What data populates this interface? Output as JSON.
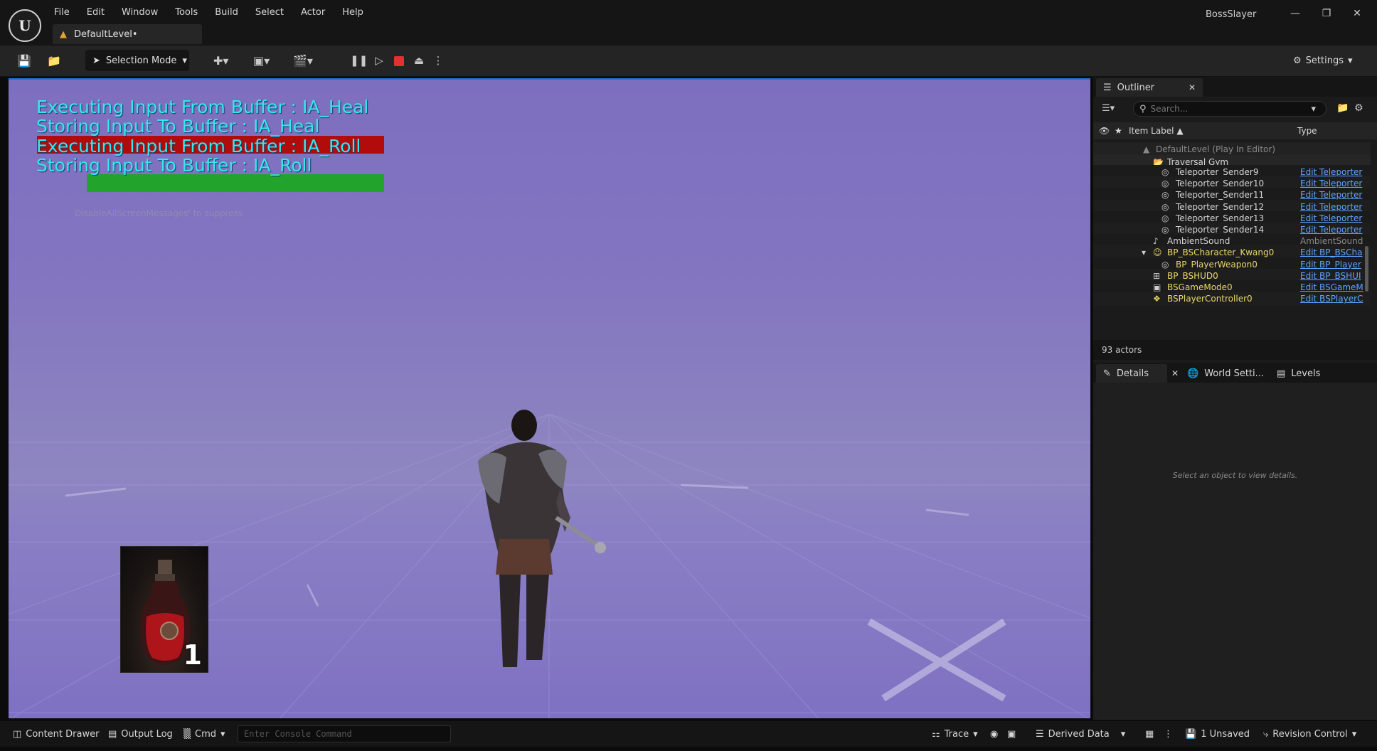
{
  "window": {
    "app_name": "BossSlayer",
    "level_tab": "DefaultLevel•",
    "controls": [
      "—",
      "❐",
      "✕"
    ]
  },
  "menu": [
    "File",
    "Edit",
    "Window",
    "Tools",
    "Build",
    "Select",
    "Actor",
    "Help"
  ],
  "toolbar": {
    "selection_mode": "Selection Mode",
    "settings": "Settings"
  },
  "viewport": {
    "debug_lines": [
      "Executing Input From Buffer : IA_Heal",
      "Storing Input To Buffer : IA_Heal",
      "Executing Input From Buffer : IA_Roll",
      "Storing Input To Buffer : IA_Roll"
    ],
    "suppress_hint": "DisableAllScreenMessages' to suppress",
    "potion_count": "1",
    "colors": {
      "debug_text": "#36e7ee",
      "bar_red": "#b20b0b",
      "bar_green": "#22a32b"
    }
  },
  "outliner": {
    "tab_label": "Outliner",
    "search_placeholder": "Search...",
    "col_item_label": "Item Label ▲",
    "col_type": "Type",
    "root": "DefaultLevel (Play In Editor)",
    "folder": "Traversal Gym",
    "rows": [
      {
        "name": "Teleporter_Sender9",
        "type": "Edit Teleporter",
        "icon": "◎",
        "indent": 2,
        "link": true
      },
      {
        "name": "Teleporter_Sender10",
        "type": "Edit Teleporter",
        "icon": "◎",
        "indent": 2,
        "link": true
      },
      {
        "name": "Teleporter_Sender11",
        "type": "Edit Teleporter",
        "icon": "◎",
        "indent": 2,
        "link": true
      },
      {
        "name": "Teleporter_Sender12",
        "type": "Edit Teleporter",
        "icon": "◎",
        "indent": 2,
        "link": true
      },
      {
        "name": "Teleporter_Sender13",
        "type": "Edit Teleporter",
        "icon": "◎",
        "indent": 2,
        "link": true
      },
      {
        "name": "Teleporter_Sender14",
        "type": "Edit Teleporter",
        "icon": "◎",
        "indent": 2,
        "link": true
      },
      {
        "name": "AmbientSound",
        "type": "AmbientSound",
        "icon": "♪",
        "indent": 1,
        "link": false
      },
      {
        "name": "BP_BSCharacter_Kwang0",
        "type": "Edit BP_BSCha",
        "icon": "☺",
        "indent": 1,
        "link": true
      },
      {
        "name": "BP_PlayerWeapon0",
        "type": "Edit BP_Player",
        "icon": "◎",
        "indent": 2,
        "link": true
      },
      {
        "name": "BP_BSHUD0",
        "type": "Edit BP_BSHUI",
        "icon": "⊞",
        "indent": 1,
        "link": true
      },
      {
        "name": "BSGameMode0",
        "type": "Edit BSGameM",
        "icon": "▣",
        "indent": 1,
        "link": true
      },
      {
        "name": "BSPlayerController0",
        "type": "Edit BSPlayerC",
        "icon": "❖",
        "indent": 1,
        "link": true
      }
    ],
    "actor_count": "93 actors"
  },
  "details": {
    "tabs": [
      "Details",
      "World Setti...",
      "Levels"
    ],
    "empty_hint": "Select an object to view details."
  },
  "statusbar": {
    "content_drawer": "Content Drawer",
    "output_log": "Output Log",
    "cmd": "Cmd",
    "console_placeholder": "Enter Console Command",
    "trace": "Trace",
    "derived_data": "Derived Data",
    "unsaved": "1 Unsaved",
    "revision_control": "Revision Control"
  }
}
